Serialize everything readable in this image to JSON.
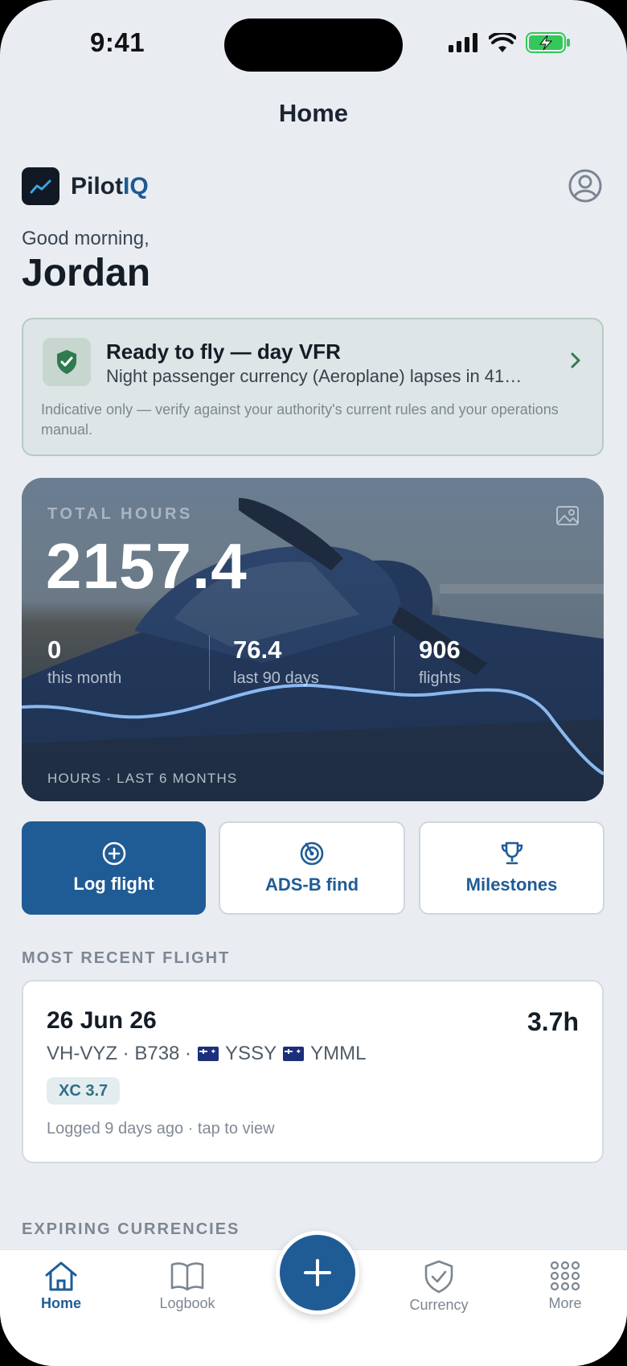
{
  "status_bar": {
    "time": "9:41"
  },
  "nav": {
    "title": "Home"
  },
  "brand": {
    "name_part1": "Pilot",
    "name_part2": "IQ"
  },
  "greeting": {
    "line1": "Good morning,",
    "name": "Jordan"
  },
  "status_card": {
    "title": "Ready to fly — day VFR",
    "subtitle": "Night passenger currency (Aeroplane) lapses in 41…",
    "note": "Indicative only — verify against your authority's current rules and your operations manual."
  },
  "hours_card": {
    "label": "TOTAL HOURS",
    "total": "2157.4",
    "stats": [
      {
        "value": "0",
        "label": "this month"
      },
      {
        "value": "76.4",
        "label": "last 90 days"
      },
      {
        "value": "906",
        "label": "flights"
      }
    ],
    "footer": "HOURS · LAST 6 MONTHS",
    "sparkline_accent": "#8ab8f0"
  },
  "actions": {
    "log_flight": "Log flight",
    "adsb_find": "ADS-B find",
    "milestones": "Milestones"
  },
  "sections": {
    "recent_flight": "MOST RECENT FLIGHT",
    "expiring": "EXPIRING CURRENCIES"
  },
  "recent_flight": {
    "date": "26 Jun 26",
    "duration": "3.7h",
    "registration": "VH-VYZ · B738 ·",
    "from": "YSSY",
    "to": "YMML",
    "badge": "XC 3.7",
    "footer": "Logged 9 days ago · tap to view"
  },
  "tabs": {
    "home": "Home",
    "logbook": "Logbook",
    "currency": "Currency",
    "more": "More"
  },
  "colors": {
    "primary": "#1f5c96",
    "background": "#e9edf2",
    "success": "#2f7a4f"
  }
}
